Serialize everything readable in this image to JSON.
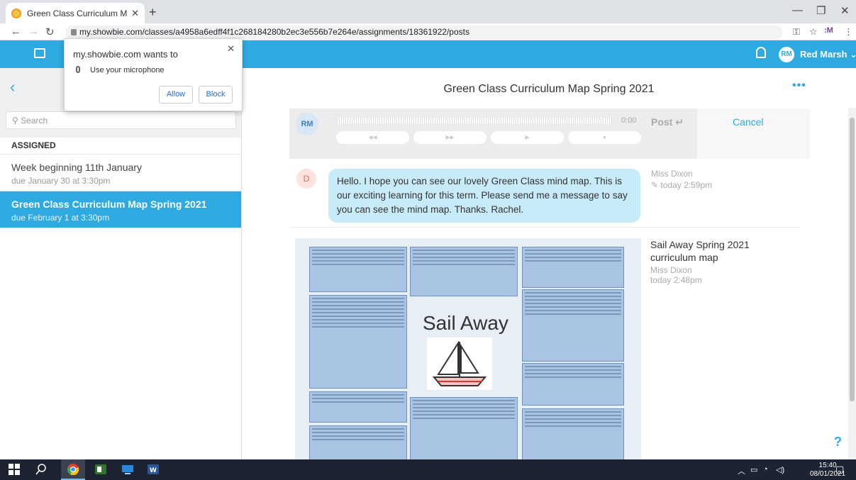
{
  "browser": {
    "tab_title": "Green Class Curriculum Map Spri",
    "url": "my.showbie.com/classes/a4958a6edff4f1c268184280b2ec3e556b7e264e/assignments/18361922/posts"
  },
  "header": {
    "user_initials": "RM",
    "user_name": "Red Marsh"
  },
  "permission_popup": {
    "title": "my.showbie.com wants to",
    "permission": "Use your microphone",
    "allow_label": "Allow",
    "block_label": "Block"
  },
  "sidebar": {
    "search_placeholder": "Search",
    "section_label": "ASSIGNED",
    "items": [
      {
        "title": "Week beginning 11th January",
        "due": "due January 30 at 3:30pm",
        "active": false
      },
      {
        "title": "Green Class Curriculum Map Spring 2021",
        "due": "due February 1 at 3:30pm",
        "active": true
      }
    ]
  },
  "main": {
    "title": "Green Class Curriculum Map Spring 2021",
    "more_label": "•••",
    "recorder": {
      "initials": "RM",
      "time": "0:00",
      "post_label": "Post",
      "cancel_label": "Cancel",
      "controls": [
        "◀◀",
        "▶▶",
        "▶",
        "●"
      ]
    },
    "message": {
      "initial": "D",
      "text": "Hello.  I hope you can see our lovely Green Class mind map.  This is our exciting learning for this term.  Please send me a message to say you can see the mind map.  Thanks.  Rachel.",
      "author": "Miss Dixon",
      "time": "today 2:59pm"
    },
    "attachment": {
      "heading": "Sail Away",
      "title": "Sail Away Spring 2021 curriculum map",
      "author": "Miss Dixon",
      "time": "today 2:48pm"
    },
    "help_label": "?"
  },
  "taskbar": {
    "time": "15:40",
    "date": "08/01/2021"
  },
  "colors": {
    "brand": "#2eaae1",
    "bubble": "#c8ebfa",
    "active_item": "#2eaae1"
  }
}
